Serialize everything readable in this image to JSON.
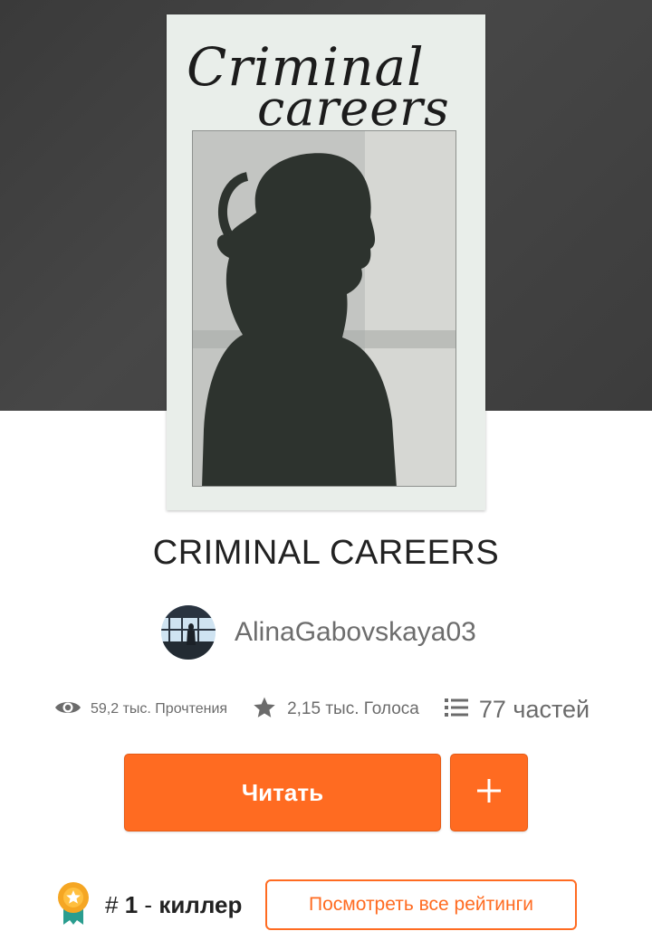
{
  "cover": {
    "title_line1": "Criminal",
    "title_line2": "careers"
  },
  "story": {
    "title": "CRIMINAL CAREERS"
  },
  "author": {
    "username": "AlinaGabovskaya03"
  },
  "stats": {
    "reads": "59,2 тыс. Прочтения",
    "votes": "2,15 тыс. Голоса",
    "parts": "77 частей"
  },
  "actions": {
    "read_label": "Читать",
    "add_label": "+"
  },
  "ranking": {
    "prefix": "#",
    "rank": "1",
    "separator": "-",
    "tag": "киллер",
    "view_all_label": "Посмотреть все рейтинги"
  },
  "colors": {
    "accent": "#ff6b21",
    "hero_bg": "#414141",
    "badge_gold": "#f5a623",
    "badge_ribbon": "#2a9d8f"
  },
  "icons": {
    "reads": "eye-icon",
    "votes": "star-icon",
    "parts": "list-icon",
    "add": "plus-icon",
    "ranking": "award-badge-icon"
  }
}
